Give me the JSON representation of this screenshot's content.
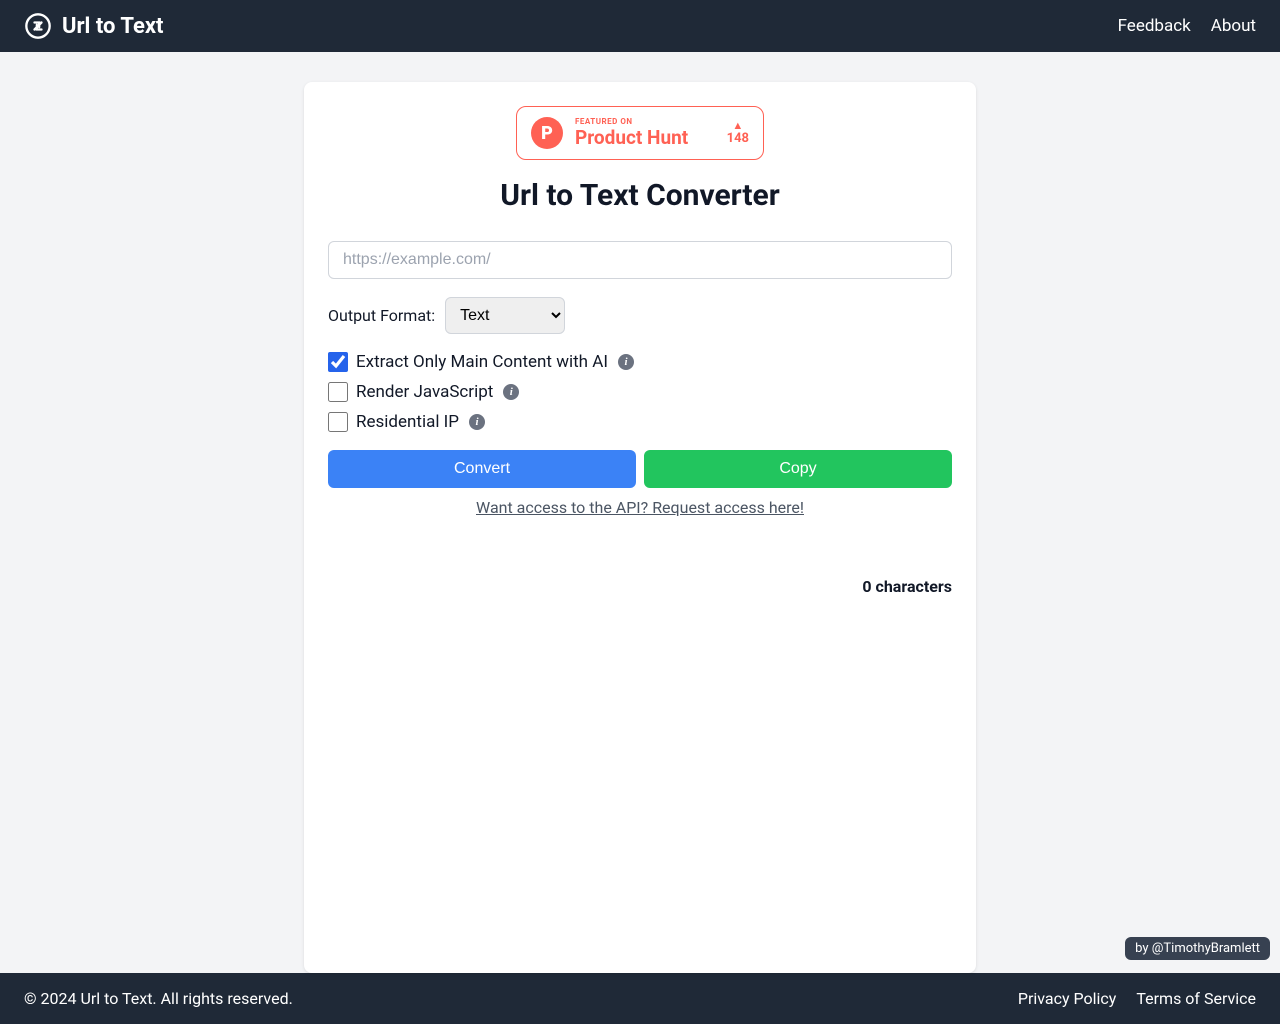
{
  "header": {
    "title": "Url to Text",
    "nav": {
      "feedback": "Feedback",
      "about": "About"
    }
  },
  "productHunt": {
    "featured": "FEATURED ON",
    "title": "Product Hunt",
    "votes": "148",
    "logoLetter": "P"
  },
  "page": {
    "title": "Url to Text Converter"
  },
  "form": {
    "urlPlaceholder": "https://example.com/",
    "formatLabel": "Output Format:",
    "formatSelected": "Text",
    "checkboxes": {
      "extractAI": {
        "label": "Extract Only Main Content with AI",
        "checked": true
      },
      "renderJS": {
        "label": "Render JavaScript",
        "checked": false
      },
      "residentialIP": {
        "label": "Residential IP",
        "checked": false
      }
    },
    "buttons": {
      "convert": "Convert",
      "copy": "Copy"
    },
    "apiLink": "Want access to the API? Request access here!"
  },
  "result": {
    "charCount": "0 characters"
  },
  "attribution": "by @TimothyBramlett",
  "footer": {
    "copyright": "© 2024 Url to Text. All rights reserved.",
    "links": {
      "privacy": "Privacy Policy",
      "terms": "Terms of Service"
    }
  },
  "infoIconChar": "i"
}
